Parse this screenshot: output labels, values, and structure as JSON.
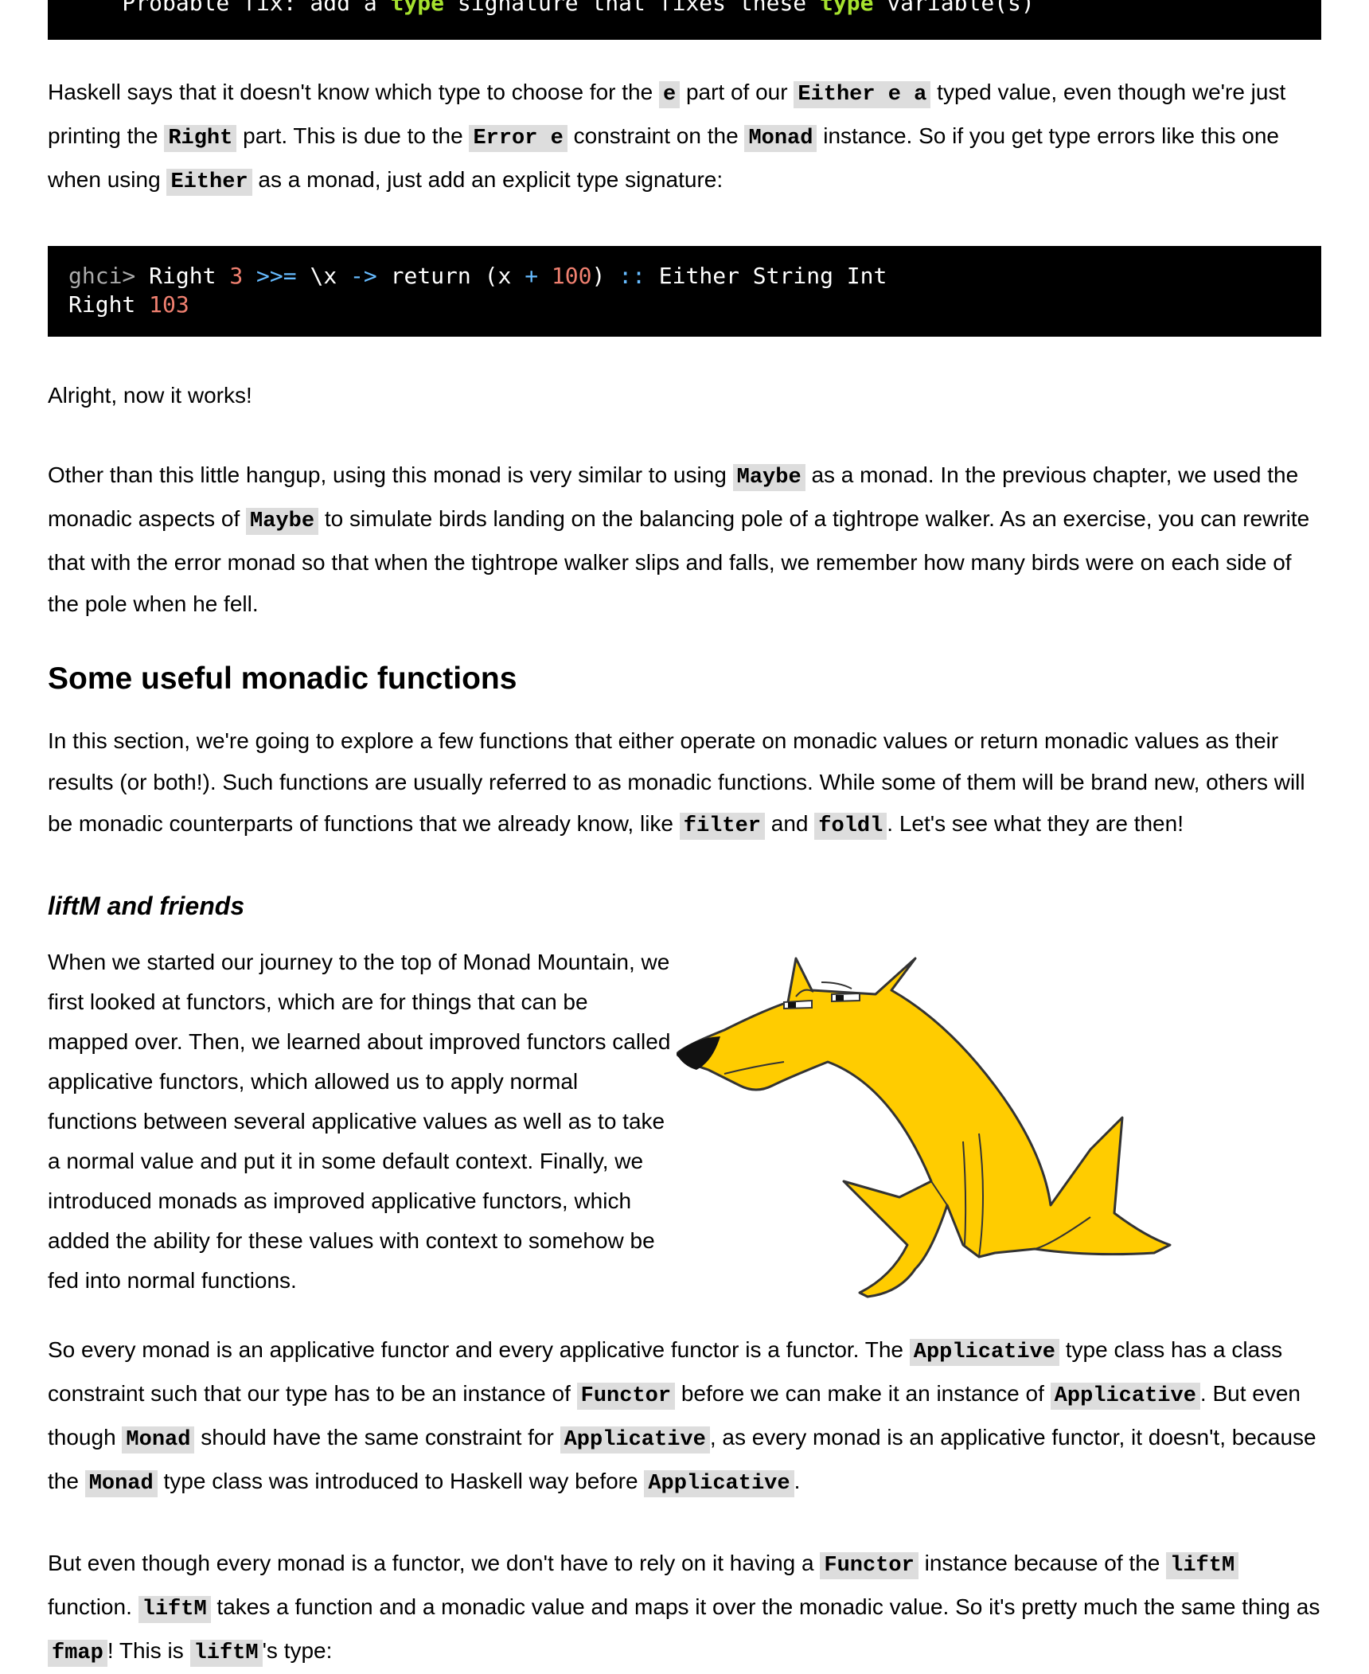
{
  "code_top": {
    "prefix": "    Probable fix: add a ",
    "kw1": "type",
    "middle": " signature that fixes these ",
    "kw2": "type",
    "suffix": " variable(s)"
  },
  "para1": {
    "t1": "Haskell says that it doesn't know which type to choose for the ",
    "c1": "e",
    "t2": " part of our ",
    "c2": "Either e a",
    "t3": " typed value, even though we're just printing the ",
    "c3": "Right",
    "t4": " part. This is due to the ",
    "c4": "Error e",
    "t5": " constraint on the ",
    "c5": "Monad",
    "t6": " instance. So if you get type errors like this one when using ",
    "c6": "Either",
    "t7": " as a monad, just add an explicit type signature:"
  },
  "code2": {
    "prompt": "ghci>",
    "right": " Right ",
    "n3": "3",
    "sp1": " ",
    "bind": ">>=",
    "lam": " \\x ",
    "arrow": "->",
    "ret": " return (x ",
    "plus": "+",
    "sp2": " ",
    "n100": "100",
    "close": ") ",
    "dcolon": "::",
    "type": " Either String Int",
    "res_right": "Right ",
    "res_num": "103"
  },
  "para2": {
    "text": "Alright, now it works!"
  },
  "para3": {
    "t1": "Other than this little hangup, using this monad is very similar to using ",
    "c1": "Maybe",
    "t2": " as a monad. In the previous chapter, we used the monadic aspects of ",
    "c2": "Maybe",
    "t3": " to simulate birds landing on the balancing pole of a tightrope walker. As an exercise, you can rewrite that with the error monad so that when the tightrope walker slips and falls, we remember how many birds were on each side of the pole when he fell."
  },
  "section_heading": "Some useful monadic functions",
  "para4": {
    "t1": "In this section, we're going to explore a few functions that either operate on monadic values or return monadic values as their results (or both!). Such functions are usually referred to as monadic functions. While some of them will be brand new, others will be monadic counterparts of functions that we already know, like ",
    "c1": "filter",
    "t2": " and ",
    "c2": "foldl",
    "t3": ". Let's see what they are then!"
  },
  "sub_heading": "liftM and friends",
  "para5": {
    "text": "When we started our journey to the top of Monad Mountain, we first looked at functors, which are for things that can be mapped over. Then, we learned about improved functors called applicative functors, which allowed us to apply normal functions between several applicative values as well as to take a normal value and put it in some default context. Finally, we introduced monads as improved applicative functors, which added the ability for these values with context to somehow be fed into normal functions."
  },
  "para6": {
    "t1": "So every monad is an applicative functor and every applicative functor is a functor. The ",
    "c1": "Applicative",
    "t2": " type class has a class constraint such that our type has to be an instance of ",
    "c2": "Functor",
    "t3": " before we can make it an instance of ",
    "c3": "Applicative",
    "t4": ". But even though ",
    "c4": "Monad",
    "t5": " should have the same constraint for ",
    "c5": "Applicative",
    "t6": ", as every monad is an applicative functor, it doesn't, because the ",
    "c6": "Monad",
    "t7": " type class was introduced to Haskell way before ",
    "c7": "Applicative",
    "t8": "."
  },
  "para7": {
    "t1": "But even though every monad is a functor, we don't have to rely on it having a ",
    "c1": "Functor",
    "t2": " instance because of the ",
    "c2": "liftM",
    "t3": " function. ",
    "c3": "liftM",
    "t4": " takes a function and a monadic value and maps it over the monadic value. So it's pretty much the same thing as ",
    "c4": "fmap",
    "t5": "! This is ",
    "c5": "liftM",
    "t6": "'s type:"
  },
  "colors": {
    "keyword": "#a6e22e",
    "number": "#f08070",
    "operator": "#66bbff",
    "dog_fill": "#ffcc00"
  }
}
